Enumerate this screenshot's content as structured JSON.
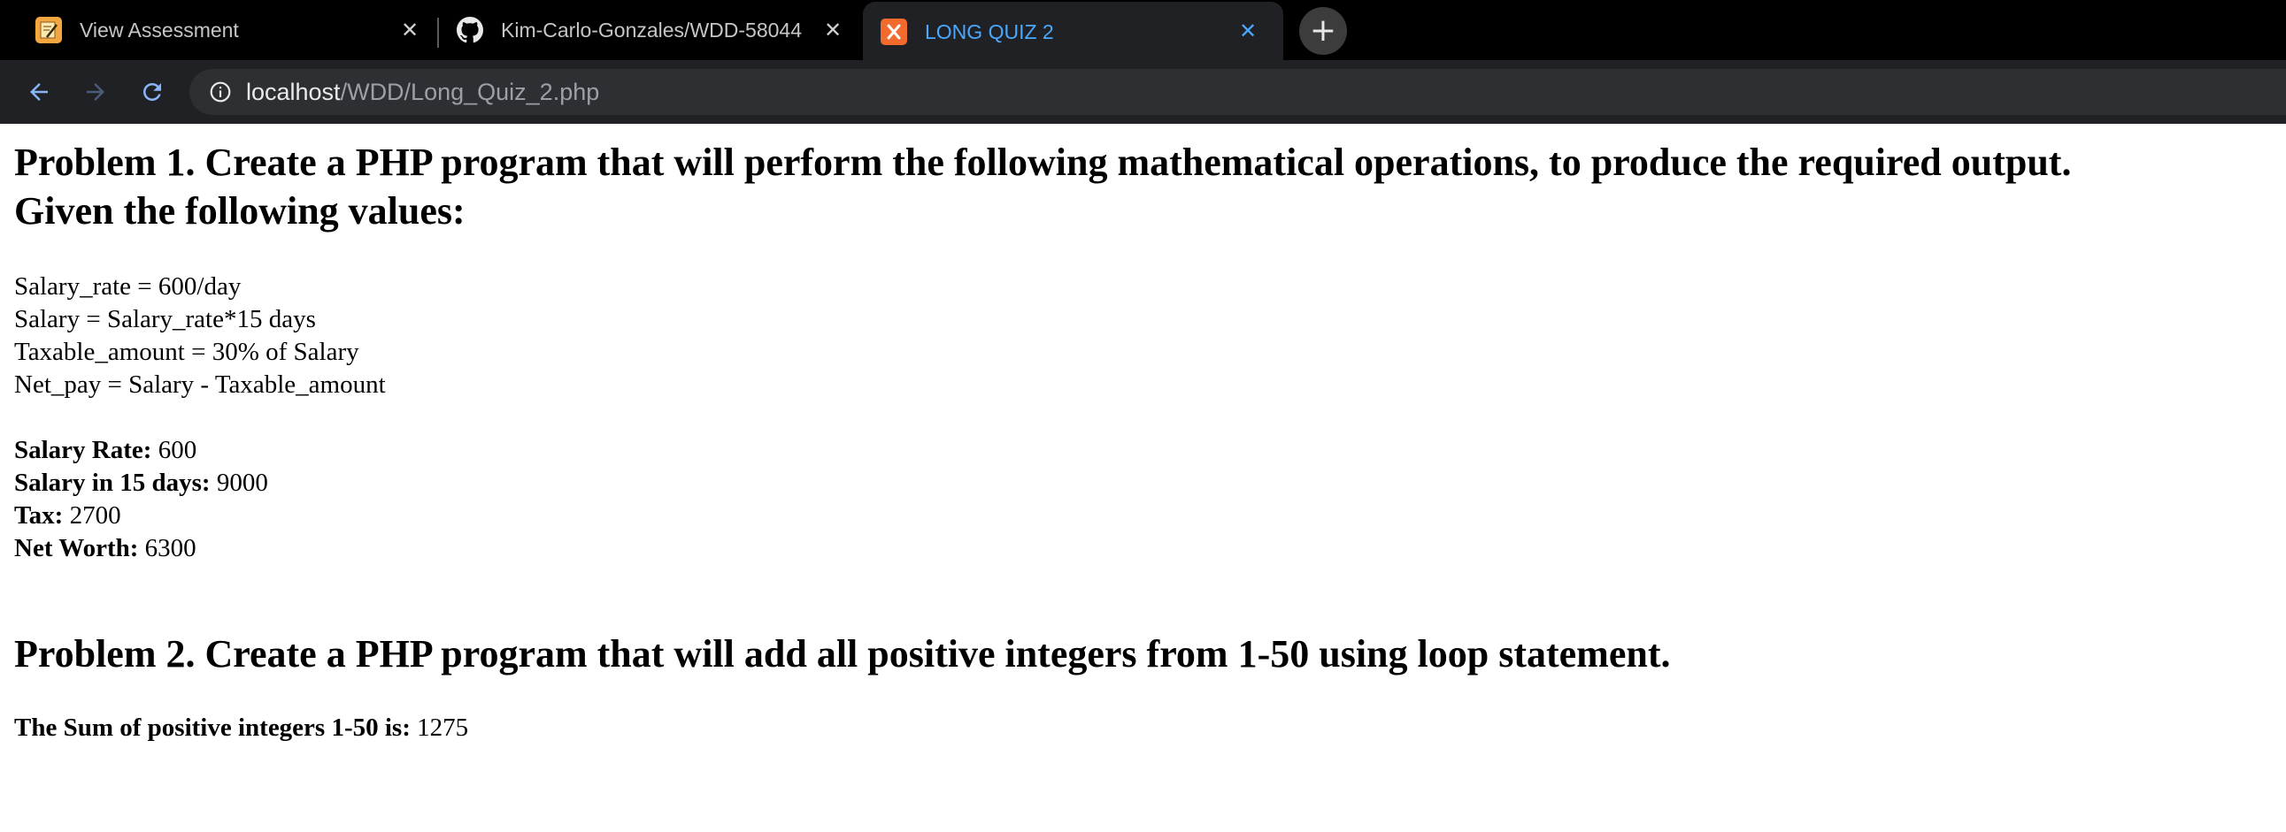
{
  "browser": {
    "tabs": [
      {
        "title": "View Assessment",
        "icon": "pencil-note-icon"
      },
      {
        "title": "Kim-Carlo-Gonzales/WDD-58044",
        "icon": "github-icon"
      },
      {
        "title": "LONG QUIZ 2",
        "icon": "xampp-icon",
        "active": true
      }
    ],
    "new_tab_label": "+",
    "close_glyph": "✕",
    "address": {
      "host": "localhost",
      "path": "/WDD/Long_Quiz_2.php"
    },
    "colors": {
      "tabbar_bg": "#000000",
      "toolbar_bg": "#202124",
      "active_tab_text": "#4aa8ff",
      "omnibox_bg": "#2e2f32"
    }
  },
  "problem1": {
    "title_line1": "Problem 1. Create a PHP program that will perform the following mathematical operations, to produce the required output.",
    "title_line2": "Given the following values:",
    "given": [
      "Salary_rate = 600/day",
      "Salary = Salary_rate*15 days",
      "Taxable_amount = 30% of Salary",
      "Net_pay = Salary - Taxable_amount"
    ],
    "results": [
      {
        "label": "Salary Rate:",
        "value": " 600"
      },
      {
        "label": "Salary in 15 days:",
        "value": " 9000"
      },
      {
        "label": "Tax:",
        "value": " 2700"
      },
      {
        "label": "Net Worth:",
        "value": " 6300"
      }
    ]
  },
  "problem2": {
    "title": "Problem 2. Create a PHP program that will add all positive integers from 1-50 using loop statement.",
    "result_label": "The Sum of positive integers 1-50 is:",
    "result_value": " 1275"
  }
}
